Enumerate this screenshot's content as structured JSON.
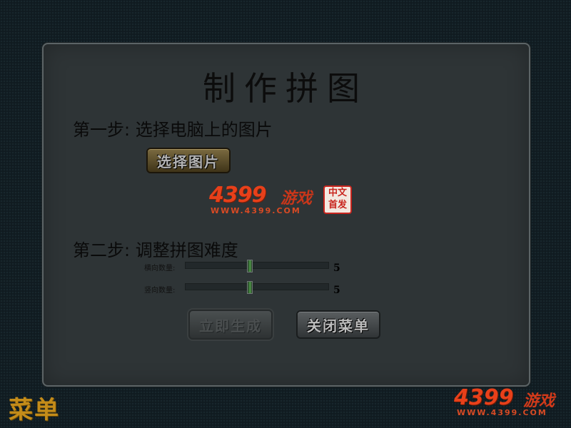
{
  "dialog": {
    "title": "制作拼图",
    "step1": "第一步: 选择电脑上的图片",
    "select_button": "选择图片",
    "step2": "第二步: 调整拼图难度",
    "sliders": [
      {
        "label": "横向数量:",
        "value": "5",
        "level": 0.45
      },
      {
        "label": "竖向数量:",
        "value": "5",
        "level": 0.45
      }
    ],
    "generate_button": "立即生成",
    "close_button": "关闭菜单"
  },
  "logo": {
    "brand": "4399",
    "game": "游戏",
    "url": "WWW.4399.COM",
    "seal_line1": "中文",
    "seal_line2": "首发"
  },
  "menu_button": "菜单",
  "corner_logo": {
    "brand": "4399",
    "game": "游戏",
    "url": "WWW.4399.COM"
  },
  "colors": {
    "dialog_bg": "#2e3436",
    "accent_orange": "#e8401a",
    "menu_gold": "#c48c1a",
    "slider_thumb": "#4f9a48"
  }
}
